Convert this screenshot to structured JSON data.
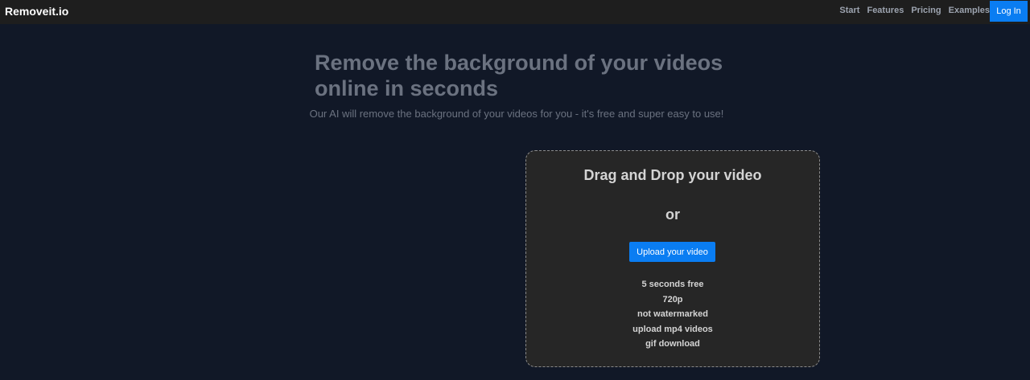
{
  "navbar": {
    "brand": "Removeit.io",
    "links": [
      "Start",
      "Features",
      "Pricing",
      "Examples"
    ],
    "login_label": "Log In"
  },
  "hero": {
    "title": "Remove the background of your videos online in seconds",
    "subtitle": "Our AI will remove the background of your videos for you - it's free and super easy to use!"
  },
  "dropzone": {
    "title": "Drag and Drop your video",
    "or_label": "or",
    "upload_label": "Upload your video",
    "features": [
      "5 seconds free",
      "720p",
      "not watermarked",
      "upload mp4 videos",
      "gif download"
    ]
  },
  "colors": {
    "background": "#111827",
    "navbar": "#1e1e1e",
    "accent": "#0a7df2",
    "dropzone": "#262626"
  }
}
